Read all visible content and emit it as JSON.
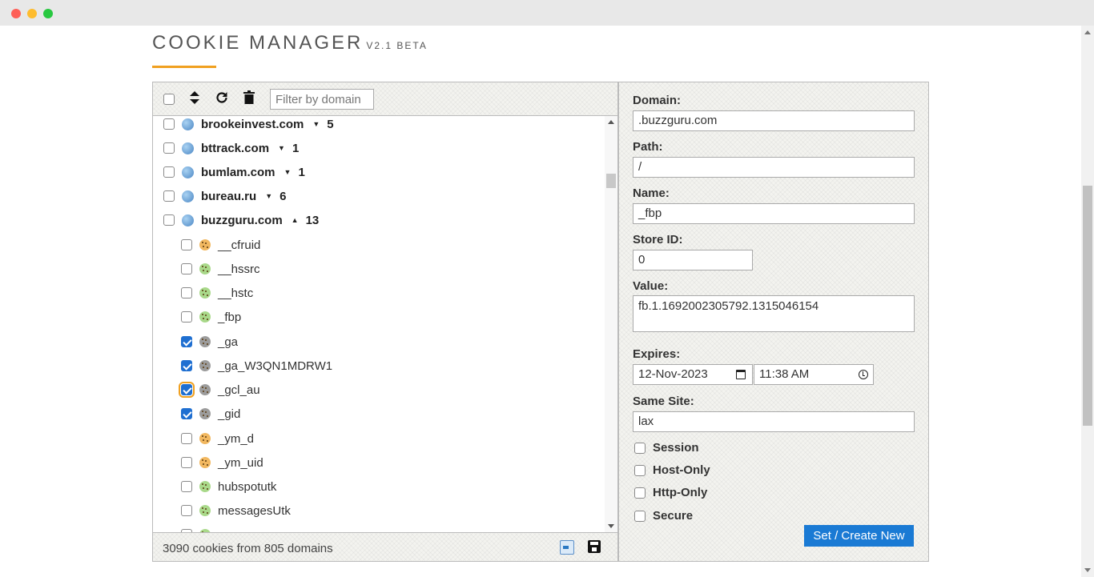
{
  "app": {
    "title": "COOKIE MANAGER",
    "version": "V2.1 BETA"
  },
  "toolbar": {
    "filter_placeholder": "Filter by domain"
  },
  "domains": [
    {
      "name": "brookeinvest.com",
      "arrow": "▼",
      "count": "5"
    },
    {
      "name": "bttrack.com",
      "arrow": "▼",
      "count": "1"
    },
    {
      "name": "bumlam.com",
      "arrow": "▼",
      "count": "1"
    },
    {
      "name": "bureau.ru",
      "arrow": "▼",
      "count": "6"
    },
    {
      "name": "buzzguru.com",
      "arrow": "▲",
      "count": "13"
    }
  ],
  "cookies": [
    {
      "name": "__cfruid",
      "icon": "cookie-orange-icon",
      "checked": false
    },
    {
      "name": "__hssrc",
      "icon": "cookie-green-icon",
      "checked": false
    },
    {
      "name": "__hstc",
      "icon": "cookie-green-icon",
      "checked": false
    },
    {
      "name": "_fbp",
      "icon": "cookie-green-icon",
      "checked": false
    },
    {
      "name": "_ga",
      "icon": "cookie-gray-icon",
      "checked": true
    },
    {
      "name": "_ga_W3QN1MDRW1",
      "icon": "cookie-gray-icon",
      "checked": true
    },
    {
      "name": "_gcl_au",
      "icon": "cookie-gray-icon",
      "checked": true
    },
    {
      "name": "_gid",
      "icon": "cookie-gray-icon",
      "checked": true
    },
    {
      "name": "_ym_d",
      "icon": "cookie-orange-icon",
      "checked": false
    },
    {
      "name": "_ym_uid",
      "icon": "cookie-orange-icon",
      "checked": false
    },
    {
      "name": "hubspotutk",
      "icon": "cookie-green-icon",
      "checked": false
    },
    {
      "name": "messagesUtk",
      "icon": "cookie-green-icon",
      "checked": false
    }
  ],
  "status": {
    "text": "3090 cookies from 805 domains"
  },
  "form": {
    "domain_label": "Domain:",
    "domain_value": ".buzzguru.com",
    "path_label": "Path:",
    "path_value": "/",
    "name_label": "Name:",
    "name_value": "_fbp",
    "store_label": "Store ID:",
    "store_value": "0",
    "value_label": "Value:",
    "value_value": "fb.1.1692002305792.1315046154",
    "expires_label": "Expires:",
    "expires_date": "12-Nov-2023",
    "expires_time": "11:38  AM",
    "samesite_label": "Same Site:",
    "samesite_value": "lax",
    "session_label": "Session",
    "hostonly_label": "Host-Only",
    "httponly_label": "Http-Only",
    "secure_label": "Secure",
    "submit_label": "Set / Create New"
  },
  "colors": {
    "accent": "#f0a020",
    "button": "#1a7ad4",
    "checkbox": "#1f6fd1"
  }
}
